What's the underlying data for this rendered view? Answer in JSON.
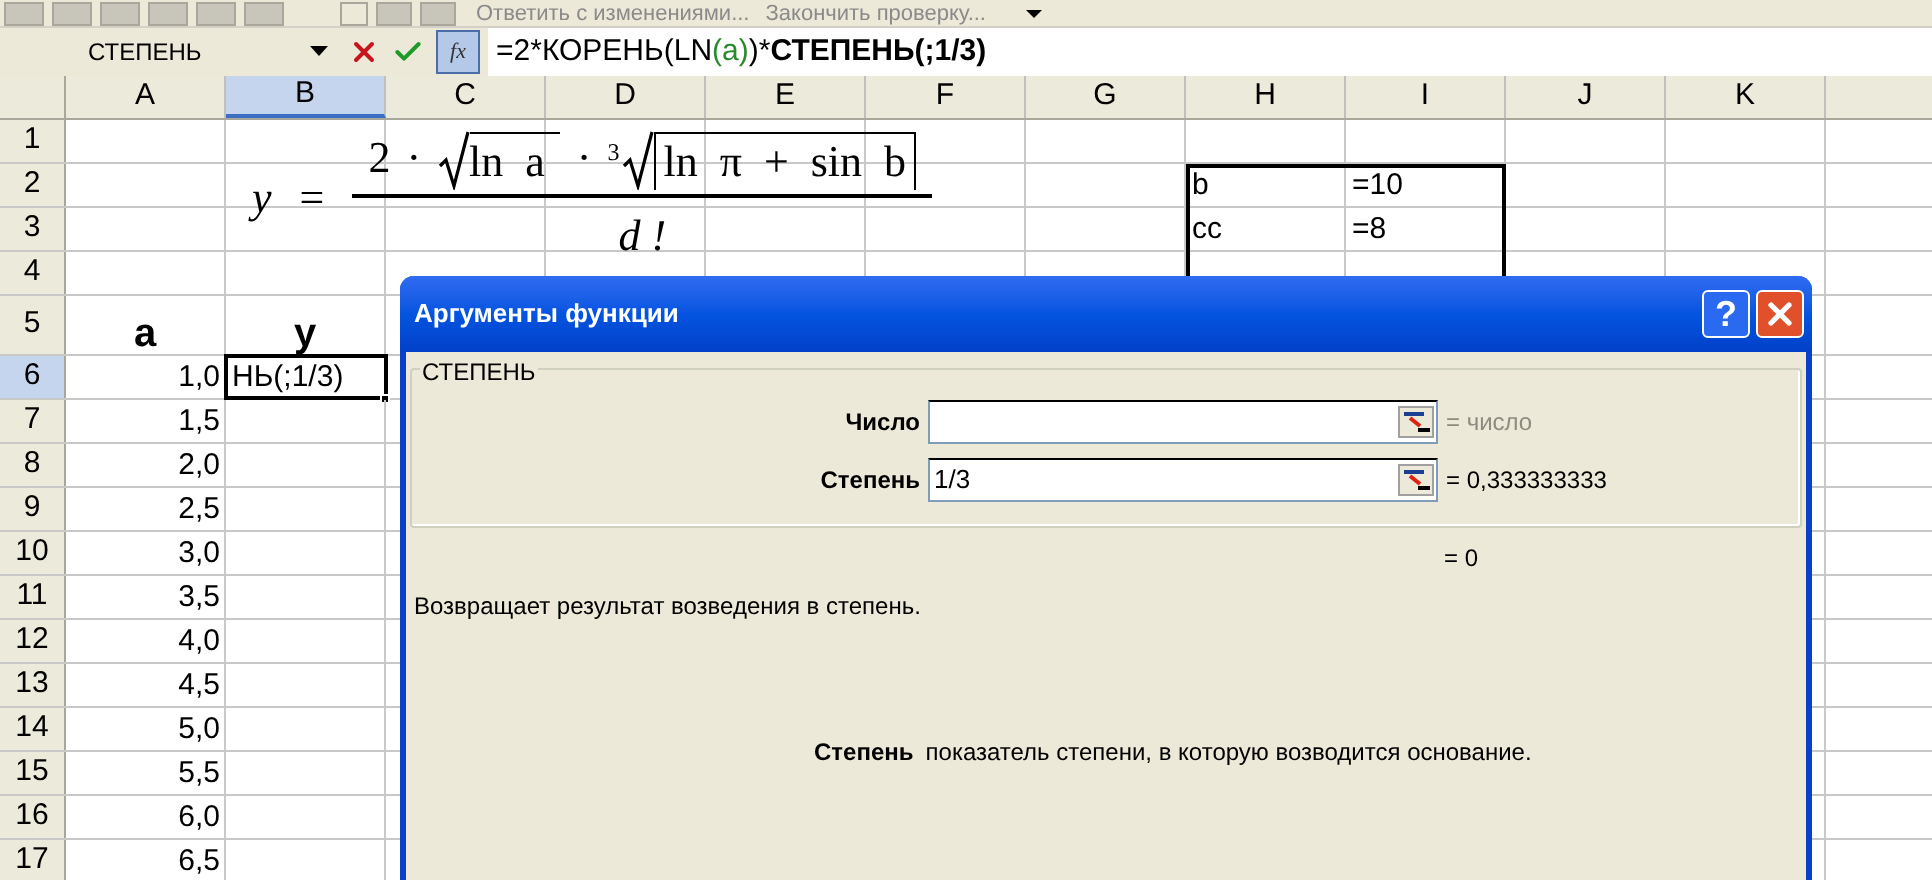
{
  "toolbar": {
    "items": [
      "Ответить с изменениями...",
      "Закончить проверку..."
    ]
  },
  "formula_bar": {
    "name_box": "СТЕПЕНЬ",
    "fx_label": "fx",
    "formula": [
      {
        "kind": "plain",
        "text": "=2*КОРЕНЬ(LN"
      },
      {
        "kind": "ref",
        "text": "(a)"
      },
      {
        "kind": "plain",
        "text": ")*"
      },
      {
        "kind": "bold",
        "text": "СТЕПЕНЬ(;1/3)"
      }
    ]
  },
  "columns": [
    {
      "label": "A",
      "selected": false
    },
    {
      "label": "B",
      "selected": true
    },
    {
      "label": "C",
      "selected": false
    },
    {
      "label": "D",
      "selected": false
    },
    {
      "label": "E",
      "selected": false
    },
    {
      "label": "F",
      "selected": false
    },
    {
      "label": "G",
      "selected": false
    },
    {
      "label": "H",
      "selected": false
    },
    {
      "label": "I",
      "selected": false
    },
    {
      "label": "J",
      "selected": false
    },
    {
      "label": "K",
      "selected": false
    }
  ],
  "rows": [
    {
      "header": "1",
      "selected": false,
      "kind": "value"
    },
    {
      "header": "2",
      "selected": false,
      "kind": "value",
      "col_h": "b",
      "col_i": "=10"
    },
    {
      "header": "3",
      "selected": false,
      "kind": "value",
      "col_h": "cc",
      "col_i": "=8"
    },
    {
      "header": "4",
      "selected": false,
      "kind": "value"
    },
    {
      "header": "5",
      "selected": false,
      "kind": "heading",
      "col_a": "a",
      "col_b": "y"
    },
    {
      "header": "6",
      "selected": true,
      "kind": "value",
      "col_a": "1,0",
      "col_b": "НЬ(;1/3)"
    },
    {
      "header": "7",
      "selected": false,
      "kind": "value",
      "col_a": "1,5"
    },
    {
      "header": "8",
      "selected": false,
      "kind": "value",
      "col_a": "2,0"
    },
    {
      "header": "9",
      "selected": false,
      "kind": "value",
      "col_a": "2,5"
    },
    {
      "header": "10",
      "selected": false,
      "kind": "value",
      "col_a": "3,0"
    },
    {
      "header": "11",
      "selected": false,
      "kind": "value",
      "col_a": "3,5"
    },
    {
      "header": "12",
      "selected": false,
      "kind": "value",
      "col_a": "4,0"
    },
    {
      "header": "13",
      "selected": false,
      "kind": "value",
      "col_a": "4,5"
    },
    {
      "header": "14",
      "selected": false,
      "kind": "value",
      "col_a": "5,0"
    },
    {
      "header": "15",
      "selected": false,
      "kind": "value",
      "col_a": "5,5"
    },
    {
      "header": "16",
      "selected": false,
      "kind": "value",
      "col_a": "6,0"
    },
    {
      "header": "17",
      "selected": false,
      "kind": "value",
      "col_a": "6,5"
    }
  ],
  "equation": {
    "lhs": "y",
    "equals": "=",
    "coefficient": "2",
    "dot_1": "·",
    "sqrt_argument": "ln  a",
    "dot_2": "·",
    "root_index": "3",
    "cbrt_argument": "ln  π  +  sin  b",
    "denominator": "d !"
  },
  "dialog": {
    "title": "Аргументы функции",
    "help_label": "?",
    "group": "СТЕПЕНЬ",
    "arguments": [
      {
        "label": "Число",
        "result": "= число",
        "kind": "hint"
      },
      {
        "label": "Степень",
        "value": "1/3",
        "result": "= 0,333333333",
        "kind": "value"
      }
    ],
    "formula_result": "= 0",
    "description": "Возвращает результат возведения в степень.",
    "argument_help": {
      "name": "Степень",
      "text": "показатель степени, в которую возводится основание."
    }
  }
}
